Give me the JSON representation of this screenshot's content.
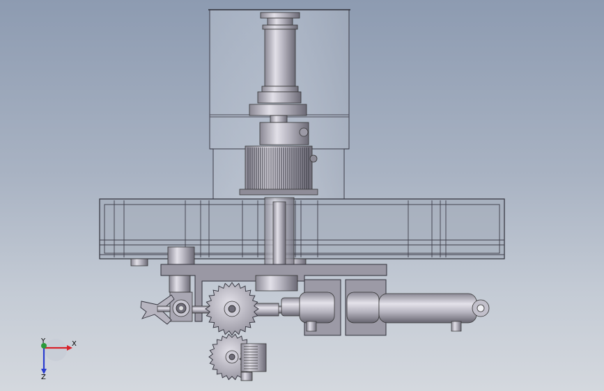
{
  "viewport": {
    "background_top": "#8d9bb1",
    "background_bottom": "#d4d8de"
  },
  "model": {
    "metal_color": "#b9b7c2",
    "metal_dark": "#6e6c78",
    "glass_color": "#c9d0dc",
    "edge_color": "#2e2e38"
  },
  "triad": {
    "x_label": "X",
    "y_label": "Y",
    "z_label": "Z",
    "x_color": "#d8222a",
    "y_color": "#2a9a3a",
    "z_color": "#2a3ccf"
  }
}
